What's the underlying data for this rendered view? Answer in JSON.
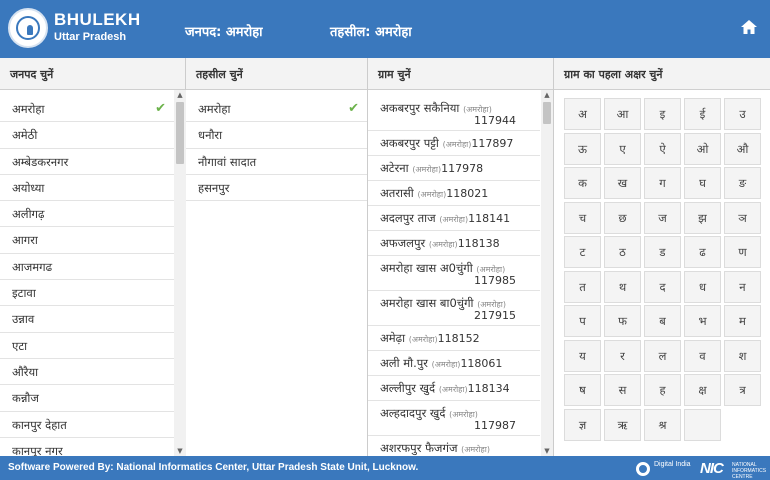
{
  "header": {
    "brand_title": "BHULEKH",
    "brand_sub": "Uttar Pradesh",
    "janpad": "जनपद: अमरोहा",
    "tehsil": "तहसील: अमरोहा",
    "home_icon": "home-icon"
  },
  "columns": {
    "janpad_head": "जनपद चुनें",
    "tehsil_head": "तहसील चुनें",
    "gram_head": "ग्राम चुनें",
    "letter_head": "ग्राम का पहला अक्षर चुनें"
  },
  "janpad_list": [
    "अमरोहा",
    "अमेठी",
    "अम्बेडकरनगर",
    "अयोध्या",
    "अलीगढ़",
    "आगरा",
    "आजमगढ",
    "इटावा",
    "उन्नाव",
    "एटा",
    "औरैया",
    "कन्नौज",
    "कानपुर देहात",
    "कानपुर नगर"
  ],
  "tehsil_list": [
    "अमरोहा",
    "धनौरा",
    "नौगावां सादात",
    "हसनपुर"
  ],
  "gram_list": [
    {
      "name": "अकबरपुर सकैनिया",
      "dist": "(अमरोहा)",
      "code": "117944"
    },
    {
      "name": "अकबरपुर पट्टी",
      "dist": "(अमरोहा)",
      "code": "117897"
    },
    {
      "name": "अटेरना",
      "dist": "(अमरोहा)",
      "code": "117978"
    },
    {
      "name": "अतरासी",
      "dist": "(अमरोहा)",
      "code": "118021"
    },
    {
      "name": "अदलपुर ताज",
      "dist": "(अमरोहा)",
      "code": "118141"
    },
    {
      "name": "अफजलपुर",
      "dist": "(अमरोहा)",
      "code": "118138"
    },
    {
      "name": "अमरोहा खास अ0चुंगी",
      "dist": "(अमरोहा)",
      "code": "117985"
    },
    {
      "name": "अमरोहा खास बा0चुंगी",
      "dist": "(अमरोहा)",
      "code": "217915"
    },
    {
      "name": "अमेढ़ा",
      "dist": "(अमरोहा)",
      "code": "118152"
    },
    {
      "name": "अली मौ.पुर",
      "dist": "(अमरोहा)",
      "code": "118061"
    },
    {
      "name": "अल्लीपुर खुर्द",
      "dist": "(अमरोहा)",
      "code": "118134"
    },
    {
      "name": "अल्हदादपुर खुर्द",
      "dist": "(अमरोहा)",
      "code": "117987"
    },
    {
      "name": "अशरफपुर फैजगंज",
      "dist": "(अमरोहा)",
      "code": ""
    }
  ],
  "letters": [
    "अ",
    "आ",
    "इ",
    "ई",
    "उ",
    "ऊ",
    "ए",
    "ऐ",
    "ओ",
    "औ",
    "क",
    "ख",
    "ग",
    "घ",
    "ङ",
    "च",
    "छ",
    "ज",
    "झ",
    "ञ",
    "ट",
    "ठ",
    "ड",
    "ढ",
    "ण",
    "त",
    "थ",
    "द",
    "ध",
    "न",
    "प",
    "फ",
    "ब",
    "भ",
    "म",
    "य",
    "र",
    "ल",
    "व",
    "श",
    "ष",
    "स",
    "ह",
    "क्ष",
    "त्र",
    "ज्ञ",
    "ऋ",
    "श्र",
    ""
  ],
  "footer": {
    "text": "Software Powered By: National Informatics Center, Uttar Pradesh State Unit, Lucknow.",
    "digital_india": "Digital India",
    "nic_mark": "NIC",
    "nic_text": "NATIONAL INFORMATICS CENTRE"
  },
  "colors": {
    "header_bg": "#3a78bd",
    "check": "#6bb24a"
  }
}
